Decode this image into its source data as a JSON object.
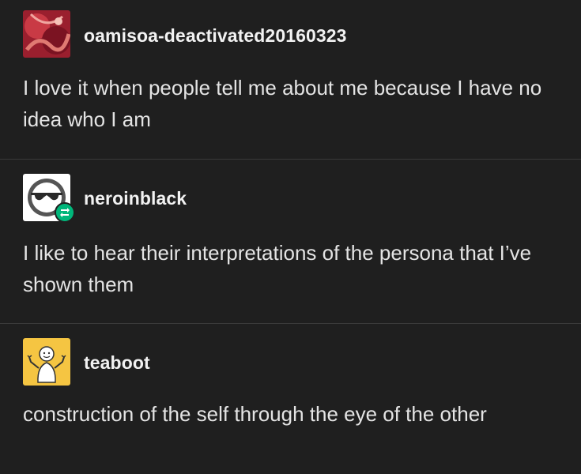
{
  "posts": [
    {
      "username": "oamisoa-deactivated20160323",
      "text": "I love it when people tell me about me because I have no idea who I am",
      "avatar_icon": "red-abstract-avatar"
    },
    {
      "username": "neroinblack",
      "text": "I like to hear their interpretations of the persona that I’ve shown them",
      "avatar_icon": "sunglasses-face-avatar",
      "badge_icon": "reblog-icon"
    },
    {
      "username": "teaboot",
      "text": "construction of the self through the eye of the other",
      "avatar_icon": "cartoon-figure-avatar"
    }
  ],
  "colors": {
    "background": "#1f1f1f",
    "divider": "#3a3a3a",
    "text": "#e4e4e4",
    "reblog_badge": "#00b67a",
    "teaboot_avatar_bg": "#f5c542"
  }
}
